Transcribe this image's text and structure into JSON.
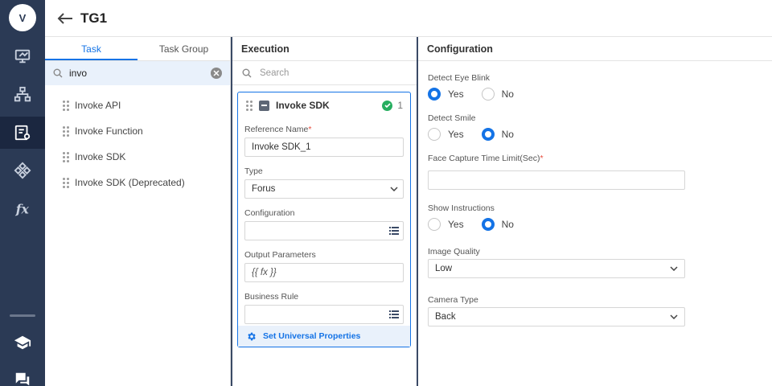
{
  "rail": {
    "avatar_initial": "V"
  },
  "header": {
    "title": "TG1"
  },
  "tasks_panel": {
    "tabs": [
      {
        "label": "Task"
      },
      {
        "label": "Task Group"
      }
    ],
    "search": {
      "value": "invo"
    },
    "items": [
      {
        "label": "Invoke API"
      },
      {
        "label": "Invoke Function"
      },
      {
        "label": "Invoke SDK"
      },
      {
        "label": "Invoke SDK (Deprecated)"
      }
    ]
  },
  "execution": {
    "title": "Execution",
    "search_placeholder": "Search",
    "card": {
      "title": "Invoke SDK",
      "count": "1",
      "reference_name_label": "Reference Name",
      "required_mark": "*",
      "reference_name_value": "Invoke SDK_1",
      "type_label": "Type",
      "type_value": "Forus",
      "configuration_label": "Configuration",
      "output_parameters_label": "Output Parameters",
      "output_parameters_value": "{{ fx }}",
      "business_rule_label": "Business Rule",
      "universal_properties_label": "Set Universal Properties"
    }
  },
  "configuration": {
    "title": "Configuration",
    "required_mark": "*",
    "detect_eye_blink": {
      "label": "Detect Eye Blink",
      "yes": "Yes",
      "no": "No"
    },
    "detect_smile": {
      "label": "Detect Smile",
      "yes": "Yes",
      "no": "No"
    },
    "face_capture_label": "Face Capture Time Limit(Sec)",
    "show_instructions": {
      "label": "Show Instructions",
      "yes": "Yes",
      "no": "No"
    },
    "image_quality": {
      "label": "Image Quality",
      "value": "Low"
    },
    "camera_type": {
      "label": "Camera Type",
      "value": "Back"
    }
  },
  "colors": {
    "rail_bg": "#2b3a55",
    "accent": "#1473e6",
    "success": "#27ae60",
    "required": "#e74c3c"
  }
}
